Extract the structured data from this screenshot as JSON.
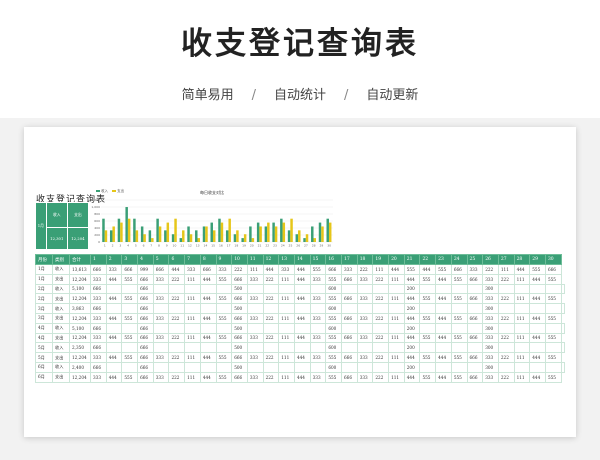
{
  "banner": {
    "title": "收支登记查询表",
    "features": [
      "简单易用",
      "自动统计",
      "自动更新"
    ],
    "separator": "/"
  },
  "sheet": {
    "title": "收支登记查询表",
    "summary": {
      "month": "1月",
      "income_label": "收入",
      "expense_label": "支出",
      "income_total": "12,301",
      "expense_total": "12,204"
    },
    "headers": [
      "月份",
      "类别",
      "合计",
      "1",
      "2",
      "3",
      "4",
      "5",
      "6",
      "7",
      "8",
      "9",
      "10",
      "11",
      "12",
      "13",
      "14",
      "15",
      "16",
      "17",
      "18",
      "19",
      "20",
      "21",
      "22",
      "23",
      "24",
      "25",
      "26",
      "27",
      "28",
      "29",
      "30"
    ],
    "rows": [
      [
        "1月",
        "收入",
        "13,613",
        "666",
        "333",
        "666",
        "999",
        "666",
        "444",
        "333",
        "666",
        "333",
        "222",
        "111",
        "444",
        "333",
        "444",
        "555",
        "666",
        "333",
        "222",
        "111",
        "444",
        "555",
        "444",
        "555",
        "666",
        "333",
        "222",
        "111",
        "444",
        "555",
        "666"
      ],
      [
        "1月",
        "支出",
        "12,204",
        "333",
        "444",
        "555",
        "666",
        "333",
        "222",
        "111",
        "444",
        "555",
        "666",
        "333",
        "222",
        "111",
        "444",
        "333",
        "555",
        "666",
        "333",
        "222",
        "111",
        "444",
        "555",
        "444",
        "555",
        "666",
        "333",
        "222",
        "111",
        "444",
        "555"
      ],
      [
        "2月",
        "收入",
        "5,100",
        "666",
        "",
        "",
        "666",
        "",
        "",
        "",
        "",
        "",
        "500",
        "",
        "",
        "",
        "",
        "",
        "600",
        "",
        "",
        "",
        "",
        "200",
        "",
        "",
        "",
        "",
        "300",
        "",
        "",
        "",
        "",
        ""
      ],
      [
        "2月",
        "支出",
        "12,204",
        "333",
        "444",
        "555",
        "666",
        "333",
        "222",
        "111",
        "444",
        "555",
        "666",
        "333",
        "222",
        "111",
        "444",
        "333",
        "555",
        "666",
        "333",
        "222",
        "111",
        "444",
        "555",
        "444",
        "555",
        "666",
        "333",
        "222",
        "111",
        "444",
        "555"
      ],
      [
        "3月",
        "收入",
        "3,863",
        "666",
        "",
        "",
        "666",
        "",
        "",
        "",
        "",
        "",
        "500",
        "",
        "",
        "",
        "",
        "",
        "600",
        "",
        "",
        "",
        "",
        "200",
        "",
        "",
        "",
        "",
        "300",
        "",
        "",
        "",
        "",
        ""
      ],
      [
        "3月",
        "支出",
        "12,204",
        "333",
        "444",
        "555",
        "666",
        "333",
        "222",
        "111",
        "444",
        "555",
        "666",
        "333",
        "222",
        "111",
        "444",
        "333",
        "555",
        "666",
        "333",
        "222",
        "111",
        "444",
        "555",
        "444",
        "555",
        "666",
        "333",
        "222",
        "111",
        "444",
        "555"
      ],
      [
        "4月",
        "收入",
        "5,100",
        "666",
        "",
        "",
        "666",
        "",
        "",
        "",
        "",
        "",
        "500",
        "",
        "",
        "",
        "",
        "",
        "600",
        "",
        "",
        "",
        "",
        "200",
        "",
        "",
        "",
        "",
        "300",
        "",
        "",
        "",
        "",
        ""
      ],
      [
        "4月",
        "支出",
        "12,204",
        "333",
        "444",
        "555",
        "666",
        "333",
        "222",
        "111",
        "444",
        "555",
        "666",
        "333",
        "222",
        "111",
        "444",
        "333",
        "555",
        "666",
        "333",
        "222",
        "111",
        "444",
        "555",
        "444",
        "555",
        "666",
        "333",
        "222",
        "111",
        "444",
        "555"
      ],
      [
        "5月",
        "收入",
        "2,350",
        "666",
        "",
        "",
        "666",
        "",
        "",
        "",
        "",
        "",
        "500",
        "",
        "",
        "",
        "",
        "",
        "600",
        "",
        "",
        "",
        "",
        "200",
        "",
        "",
        "",
        "",
        "300",
        "",
        "",
        "",
        "",
        ""
      ],
      [
        "5月",
        "支出",
        "12,204",
        "333",
        "444",
        "555",
        "666",
        "333",
        "222",
        "111",
        "444",
        "555",
        "666",
        "333",
        "222",
        "111",
        "444",
        "333",
        "555",
        "666",
        "333",
        "222",
        "111",
        "444",
        "555",
        "444",
        "555",
        "666",
        "333",
        "222",
        "111",
        "444",
        "555"
      ],
      [
        "6月",
        "收入",
        "2,400",
        "666",
        "",
        "",
        "666",
        "",
        "",
        "",
        "",
        "",
        "500",
        "",
        "",
        "",
        "",
        "",
        "600",
        "",
        "",
        "",
        "",
        "200",
        "",
        "",
        "",
        "",
        "300",
        "",
        "",
        "",
        "",
        ""
      ],
      [
        "6月",
        "支出",
        "12,204",
        "333",
        "444",
        "555",
        "666",
        "333",
        "222",
        "111",
        "444",
        "555",
        "666",
        "333",
        "222",
        "111",
        "444",
        "333",
        "555",
        "666",
        "333",
        "222",
        "111",
        "444",
        "555",
        "444",
        "555",
        "666",
        "333",
        "222",
        "111",
        "444",
        "555"
      ]
    ]
  },
  "colors": {
    "green": "#3a9f76",
    "yellow": "#e6c619"
  },
  "chart_data": {
    "type": "bar",
    "title": "每日收支对比",
    "categories": [
      "1",
      "2",
      "3",
      "4",
      "5",
      "6",
      "7",
      "8",
      "9",
      "10",
      "11",
      "12",
      "13",
      "14",
      "15",
      "16",
      "17",
      "18",
      "19",
      "20",
      "21",
      "22",
      "23",
      "24",
      "25",
      "26",
      "27",
      "28",
      "29",
      "30"
    ],
    "series": [
      {
        "name": "收入",
        "color": "#3a9f76",
        "values": [
          666,
          333,
          666,
          999,
          666,
          444,
          333,
          666,
          333,
          222,
          111,
          444,
          333,
          444,
          555,
          666,
          333,
          222,
          111,
          444,
          555,
          444,
          555,
          666,
          333,
          222,
          111,
          444,
          555,
          666
        ]
      },
      {
        "name": "支出",
        "color": "#e6c619",
        "values": [
          333,
          444,
          555,
          666,
          333,
          222,
          111,
          444,
          555,
          666,
          333,
          222,
          111,
          444,
          333,
          555,
          666,
          333,
          222,
          111,
          444,
          555,
          444,
          555,
          666,
          333,
          222,
          111,
          444,
          555
        ]
      }
    ],
    "ylim": [
      0,
      1200
    ],
    "yticks": [
      "1,200",
      "1,000",
      "800",
      "600",
      "400",
      "200",
      "0"
    ],
    "legend": "top-left",
    "grid": true
  }
}
